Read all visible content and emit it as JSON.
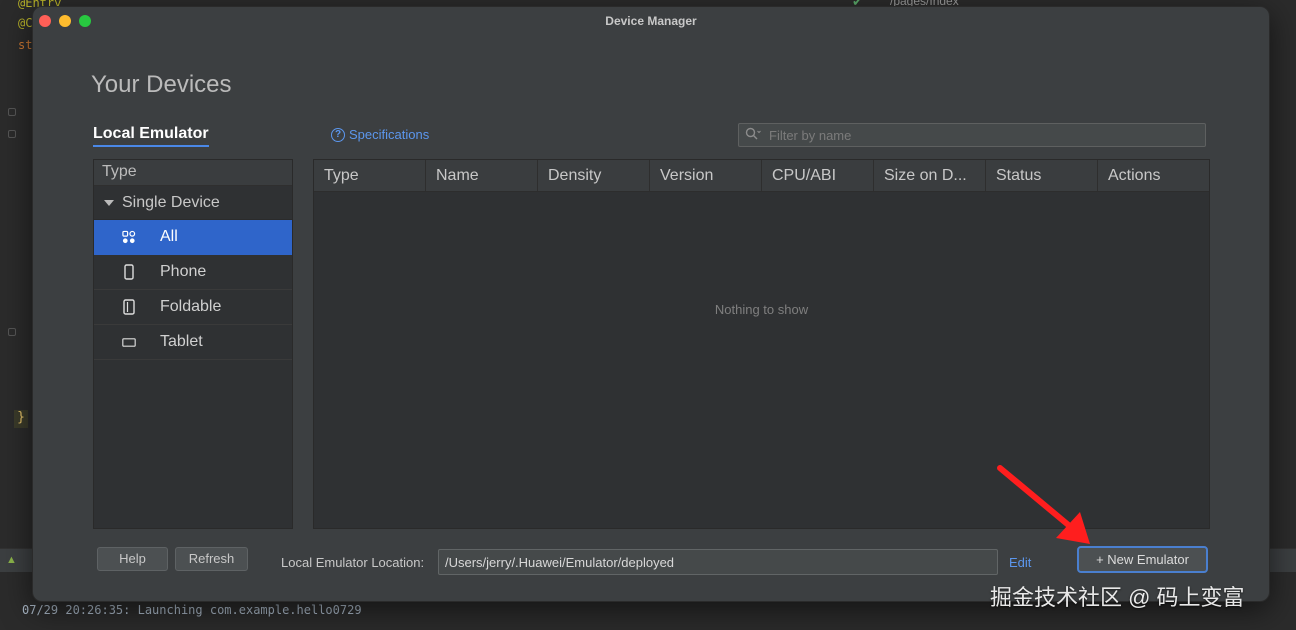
{
  "background_ide": {
    "code_lines": [
      "@Entry",
      "@Co",
      "st"
    ],
    "closing_brace": "}",
    "right_path": "/pages/Index",
    "console_line": "07/29 20:26:35: Launching com.example.hello0729"
  },
  "window": {
    "title": "Device Manager"
  },
  "page": {
    "title": "Your Devices"
  },
  "tabs": {
    "local_emulator": "Local Emulator"
  },
  "specifications_link": "Specifications",
  "filter": {
    "placeholder": "Filter by name"
  },
  "type_panel": {
    "header": "Type",
    "group": "Single Device",
    "items": [
      {
        "label": "All",
        "icon": "all-devices-icon",
        "active": true
      },
      {
        "label": "Phone",
        "icon": "phone-icon",
        "active": false
      },
      {
        "label": "Foldable",
        "icon": "foldable-icon",
        "active": false
      },
      {
        "label": "Tablet",
        "icon": "tablet-icon",
        "active": false
      }
    ]
  },
  "device_table": {
    "columns": [
      "Type",
      "Name",
      "Density",
      "Version",
      "CPU/ABI",
      "Size on D...",
      "Status",
      "Actions"
    ],
    "rows": [],
    "empty_message": "Nothing to show"
  },
  "footer": {
    "help_label": "Help",
    "refresh_label": "Refresh",
    "location_label": "Local Emulator Location:",
    "location_value": "/Users/jerry/.Huawei/Emulator/deployed",
    "edit_label": "Edit",
    "new_emulator_label": "+ New Emulator"
  },
  "watermark": "掘金技术社区 @ 码上变富",
  "colors": {
    "accent": "#2f65ca",
    "link": "#5c97ee",
    "arrow": "#ff1e1e"
  }
}
